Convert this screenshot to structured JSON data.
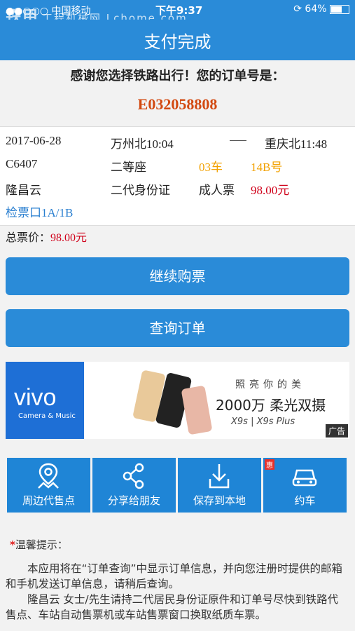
{
  "status_bar": {
    "carrier": "●●○○○ 中国移动",
    "time": "下午9:37",
    "battery_text": "64%",
    "battery_level": 0.64,
    "watermark": "铁甲",
    "watermark_sub": "工程机械网 Lchome.com"
  },
  "header": {
    "title": "支付完成"
  },
  "thanks": "感谢您选择铁路出行！您的订单号是：",
  "order_number": "E032058808",
  "ticket": {
    "date": "2017-06-28",
    "departure": "万州北10:04",
    "arrival": "重庆北11:48",
    "train": "C6407",
    "seat_class": "二等座",
    "car": "03车",
    "seat": "14B号",
    "passenger": "隆昌云",
    "id_type": "二代身份证",
    "ticket_type": "成人票",
    "price": "98.00元",
    "gate": "检票口1A/1B"
  },
  "total": {
    "label": "总票价：",
    "value": "98.00元"
  },
  "buttons": {
    "continue": "继续购票",
    "query": "查询订单"
  },
  "ad": {
    "brand": "vivo",
    "brand_tag": "Camera & Music",
    "slogan": "照亮你的美",
    "headline": "2000万 柔光双摄",
    "models": "X9s | X9s Plus",
    "tag": "广告"
  },
  "tiles": [
    {
      "label": "周边代售点",
      "icon": "location-map-icon"
    },
    {
      "label": "分享给朋友",
      "icon": "share-icon"
    },
    {
      "label": "保存到本地",
      "icon": "download-icon"
    },
    {
      "label": "约车",
      "icon": "car-icon",
      "badge": "惠"
    }
  ],
  "tips": {
    "star": "*",
    "title": "温馨提示：",
    "p1": "本应用将在“订单查询”中显示订单信息，并向您注册时提供的邮箱和手机发送订单信息，请稍后查询。",
    "p2": "隆昌云 女士/先生请持二代居民身份证原件和订单号尽快到铁路代售点、车站自动售票机或车站售票窗口换取纸质车票。"
  },
  "colors": {
    "primary": "#2a8bd8",
    "order_number": "#d2480f",
    "price": "#d0021b",
    "seat": "#f2a100"
  }
}
